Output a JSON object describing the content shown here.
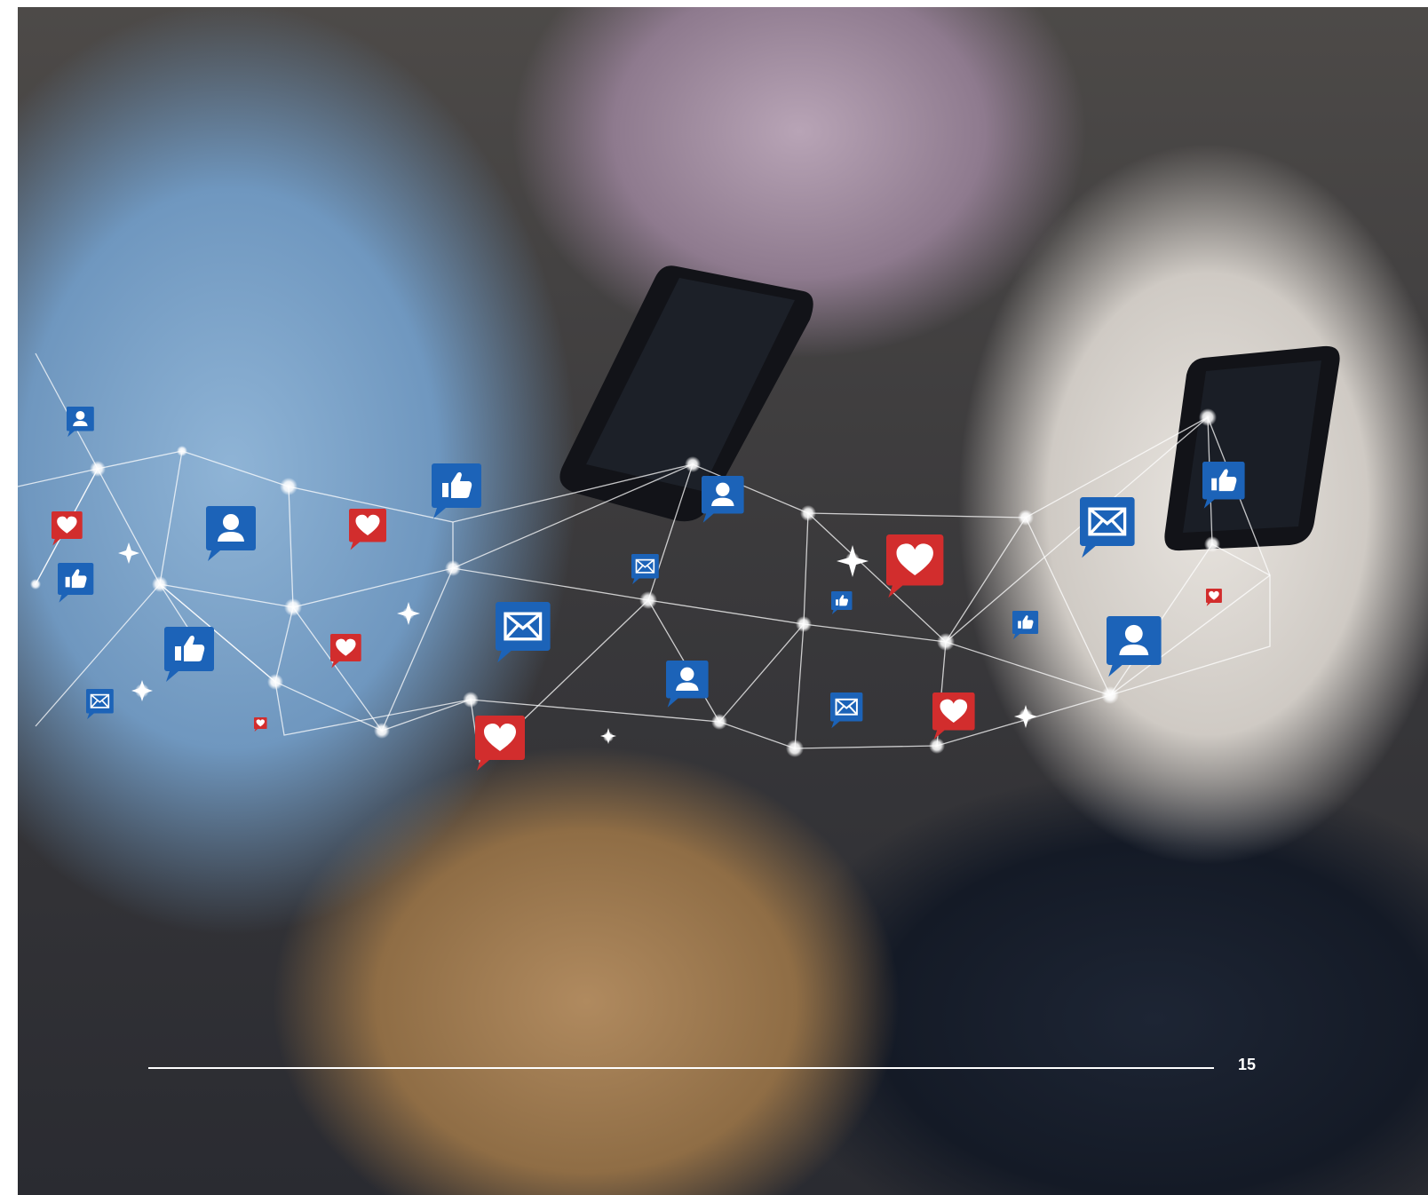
{
  "page": {
    "number": "15"
  },
  "photo": {
    "icons": [
      "user-icon",
      "thumbs-up-icon",
      "heart-icon",
      "mail-icon"
    ]
  },
  "colors": {
    "icon_blue": "#1c63b8",
    "icon_red": "#d22d2d",
    "network_line": "#ffffff",
    "divider": "#ffffff",
    "page_number": "#ffffff"
  }
}
